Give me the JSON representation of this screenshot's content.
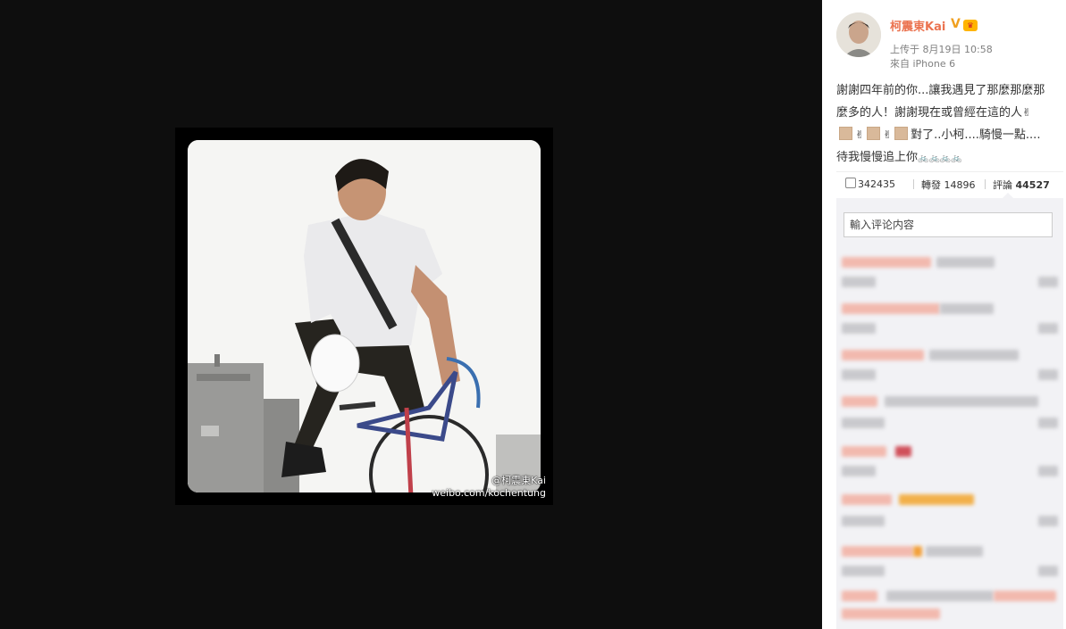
{
  "viewer": {
    "watermark_user": "@柯震東Kai",
    "watermark_url": "weibo.com/kochentung"
  },
  "post": {
    "username": "柯震東Kai",
    "verified_badge": "V",
    "posted": "上传于 8月19日 10:58",
    "source": "來自 iPhone 6",
    "text_line1": "謝謝四年前的你...讓我遇見了那麼那麼那",
    "text_line2a": "麼多的人！謝謝現在或曾經在這的人",
    "text_line3": "對了..小柯....騎慢一點....",
    "text_line4": "待我慢慢追上你",
    "emoji_peace": "✌",
    "bikes": "🚲🚲🚲🚲",
    "likes": "342435",
    "forward_label": "轉發",
    "forward_count": "14896",
    "comment_label": "評論",
    "comment_count": "44527",
    "comment_placeholder": "輸入评论内容"
  },
  "colors": {
    "username": "#eb7350",
    "background": "#0f0f0f",
    "comment_bg": "#f2f2f5"
  },
  "icons": [
    "like-icon",
    "verified-icon",
    "vip-icon"
  ]
}
